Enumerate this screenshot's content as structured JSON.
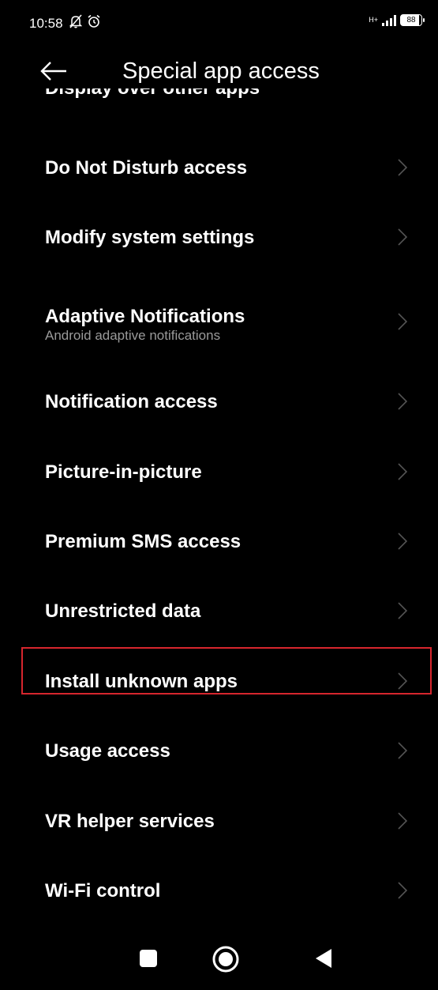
{
  "status_bar": {
    "time": "10:58",
    "network_label": "H+",
    "battery": "88",
    "icons": [
      "mute-icon",
      "alarm-icon",
      "signal-icon",
      "battery-icon"
    ]
  },
  "header": {
    "title": "Special app access",
    "back_icon": "back-arrow-icon"
  },
  "list": {
    "cut_off_item": "Display over other apps",
    "items": [
      {
        "label": "Do Not Disturb access",
        "subtitle": ""
      },
      {
        "label": "Modify system settings",
        "subtitle": ""
      },
      {
        "label": "Adaptive Notifications",
        "subtitle": "Android adaptive notifications"
      },
      {
        "label": "Notification access",
        "subtitle": ""
      },
      {
        "label": "Picture-in-picture",
        "subtitle": ""
      },
      {
        "label": "Premium SMS access",
        "subtitle": ""
      },
      {
        "label": "Unrestricted data",
        "subtitle": ""
      },
      {
        "label": "Install unknown apps",
        "subtitle": ""
      },
      {
        "label": "Usage access",
        "subtitle": ""
      },
      {
        "label": "VR helper services",
        "subtitle": ""
      },
      {
        "label": "Wi-Fi control",
        "subtitle": ""
      }
    ],
    "highlighted_item": "Install unknown apps",
    "highlight_color": "#d6262d"
  },
  "nav_bar": {
    "buttons": [
      "recents-square-icon",
      "home-circle-icon",
      "back-triangle-icon"
    ]
  }
}
